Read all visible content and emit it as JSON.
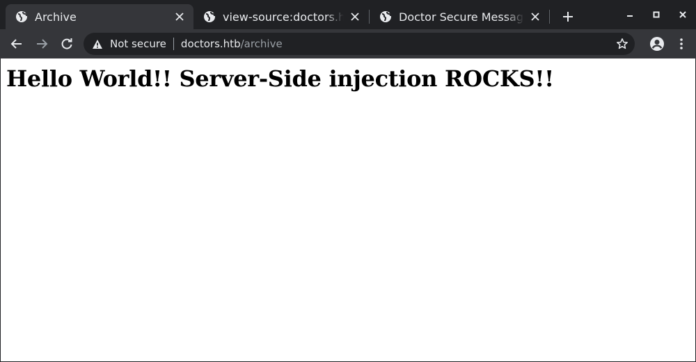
{
  "browser": {
    "tabs": [
      {
        "title": "Archive",
        "active": true,
        "favicon": "globe-icon"
      },
      {
        "title": "view-source:doctors.htb/archive",
        "active": false,
        "favicon": "globe-icon"
      },
      {
        "title": "Doctor Secure Messaging",
        "active": false,
        "favicon": "globe-icon"
      }
    ],
    "new_tab_icon": "plus-icon",
    "window_controls": [
      "minimize-icon",
      "maximize-icon",
      "close-icon"
    ]
  },
  "toolbar": {
    "security_icon": "warning-icon",
    "security_label": "Not secure",
    "url_host": "doctors.htb",
    "url_path": "/archive",
    "icons": [
      "back-arrow-icon",
      "forward-arrow-icon",
      "reload-icon",
      "star-icon",
      "profile-icon",
      "kebab-menu-icon"
    ]
  },
  "colors": {
    "tabstrip_bg": "#202124",
    "toolbar_bg": "#35363a",
    "omnibox_bg": "#202124",
    "text_light": "#e8eaed",
    "text_dim": "#9aa0a6"
  },
  "page": {
    "heading": "Hello World!! Server-Side injection ROCKS!!"
  }
}
